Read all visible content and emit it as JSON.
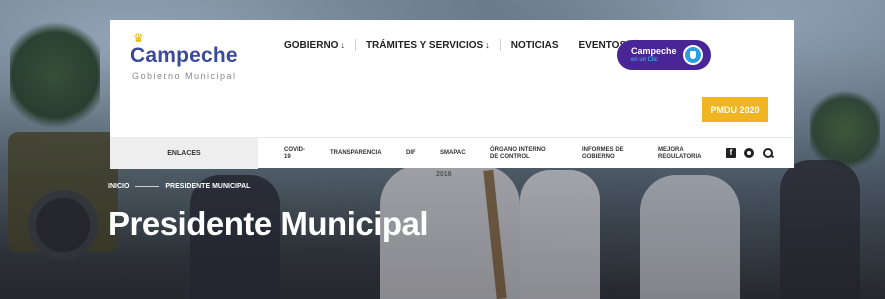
{
  "logo": {
    "title": "Campeche",
    "subtitle": "Gobierno Municipal",
    "crown_icon": "crown-icon",
    "colors": {
      "title": "#3b4a9a",
      "crown": "#e5b400"
    }
  },
  "nav_top": {
    "items": [
      {
        "label": "GOBIERNO",
        "caret": "↓"
      },
      {
        "label": "TRÁMITES Y SERVICIOS",
        "caret": "↓"
      },
      {
        "label": "NOTICIAS",
        "caret": ""
      },
      {
        "label": "EVENTOS",
        "caret": ""
      }
    ]
  },
  "badge": {
    "main": "Campeche",
    "sub": "en un Clic",
    "color": "#4a2596"
  },
  "pmdu_button": {
    "label": "PMDU 2020",
    "color": "#f0b521"
  },
  "nav_bottom": {
    "enlaces": "ENLACES",
    "links": [
      "COVID-\n19",
      "TRANSPARENCIA",
      "DIF",
      "SMAPAC",
      "ÓRGANO INTERNO\nDE CONTROL",
      "INFORMES DE\nGOBIERNO",
      "MEJORA\nREGULATORIA"
    ],
    "social_icons": [
      "facebook-icon",
      "instagram-icon",
      "search-icon"
    ],
    "facebook_glyph": "f"
  },
  "hero": {
    "breadcrumb": {
      "home": "INICIO",
      "current": "PRESIDENTE MUNICIPAL"
    },
    "year_tag": "2018",
    "title": "Presidente Municipal"
  }
}
